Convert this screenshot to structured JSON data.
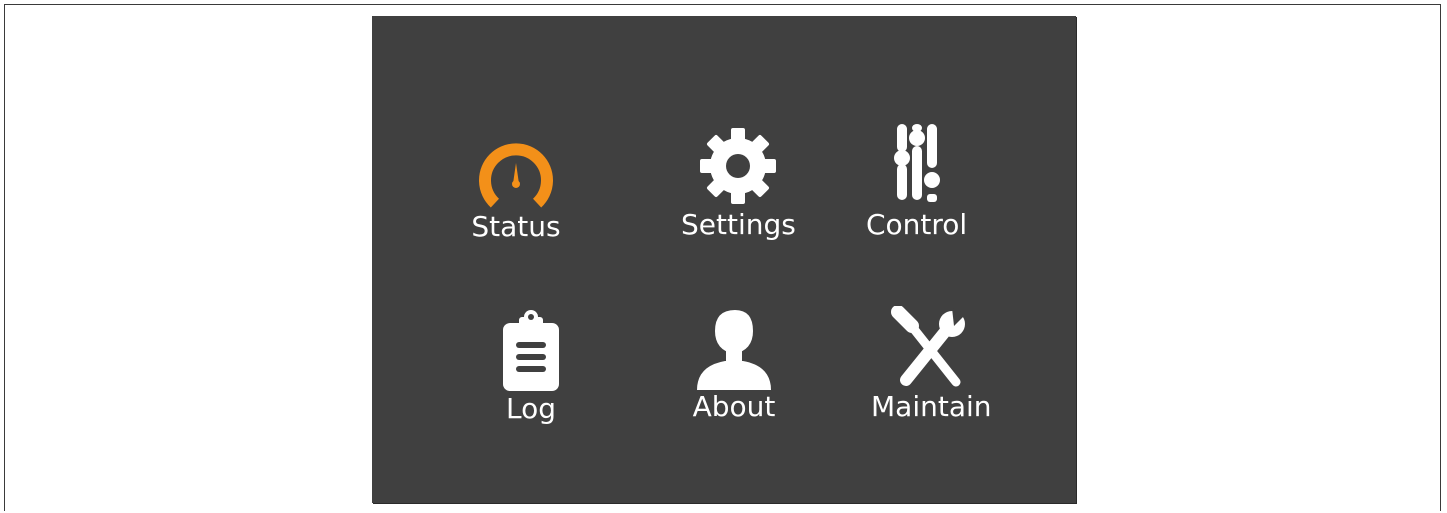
{
  "menu": {
    "accent_color": "#F39019",
    "background_color": "#404040",
    "icon_color": "#FFFFFF",
    "items": [
      {
        "label": "Status",
        "icon": "gauge-icon",
        "active": true
      },
      {
        "label": "Settings",
        "icon": "gear-icon",
        "active": false
      },
      {
        "label": "Control",
        "icon": "sliders-icon",
        "active": false
      },
      {
        "label": "Log",
        "icon": "clipboard-icon",
        "active": false
      },
      {
        "label": "About",
        "icon": "person-icon",
        "active": false
      },
      {
        "label": "Maintain",
        "icon": "tools-icon",
        "active": false
      }
    ]
  }
}
